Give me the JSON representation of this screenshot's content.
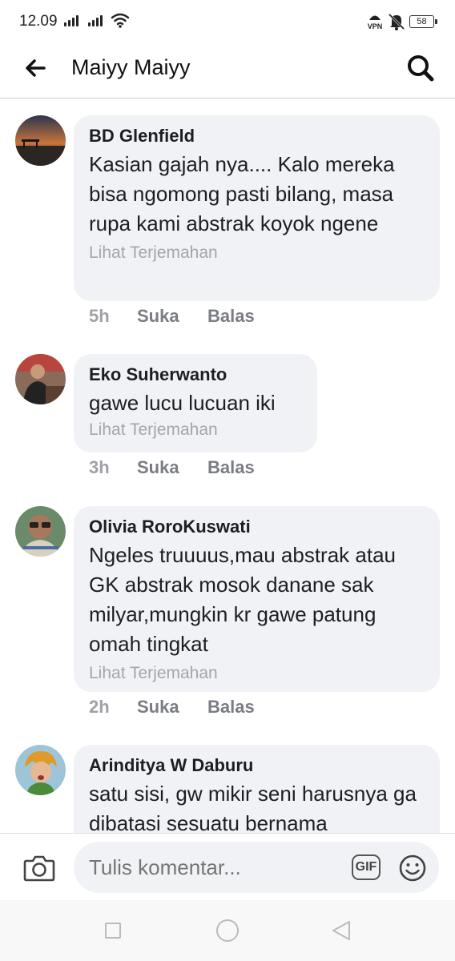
{
  "status_bar": {
    "time": "12.09",
    "vpn_label": "VPN",
    "battery": "58"
  },
  "header": {
    "title": "Maiyy Maiyy",
    "back_icon": "arrow-left-icon",
    "search_icon": "search-icon"
  },
  "comments": [
    {
      "author": "BD Glenfield",
      "text": "Kasian gajah nya.... Kalo mereka bisa ngomong pasti bilang, masa rupa kami abstrak koyok ngene",
      "translate": "Lihat Terjemahan",
      "time": "5h",
      "like": "Suka",
      "reply": "Balas"
    },
    {
      "author": "Eko Suherwanto",
      "text": "gawe lucu lucuan iki",
      "translate": "Lihat Terjemahan",
      "time": "3h",
      "like": "Suka",
      "reply": "Balas"
    },
    {
      "author": "Olivia RoroKuswati",
      "text": "Ngeles truuuus,mau abstrak atau GK abstrak mosok danane sak milyar,mungkin kr gawe patung omah tingkat",
      "translate": "Lihat Terjemahan",
      "time": "2h",
      "like": "Suka",
      "reply": "Balas"
    },
    {
      "author": "Arinditya W Daburu",
      "text": "satu sisi, gw mikir seni harusnya ga dibatasi sesuatu bernama"
    }
  ],
  "composer": {
    "placeholder": "Tulis komentar...",
    "gif_label": "GIF",
    "camera_icon": "camera-icon",
    "emoji_icon": "emoji-icon"
  },
  "colors": {
    "bubble_bg": "#f0f2f5",
    "muted_text": "#7a7d82",
    "translate_text": "#a3a6ab"
  }
}
